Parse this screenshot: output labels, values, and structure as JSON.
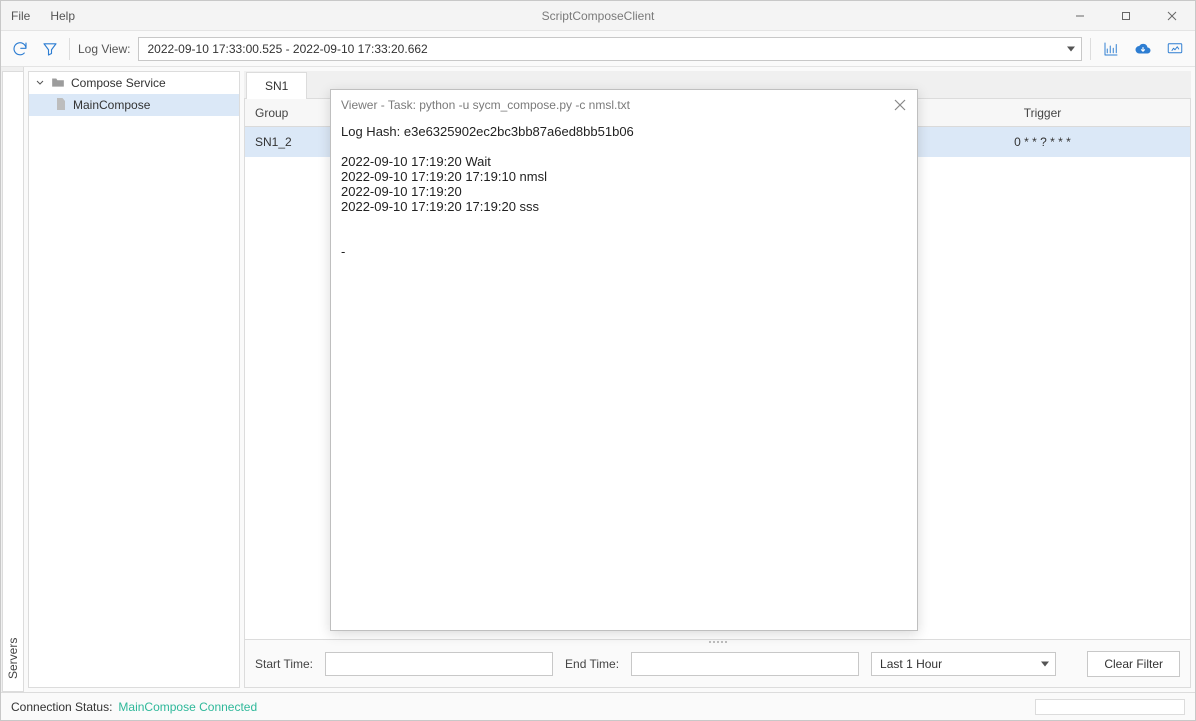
{
  "window": {
    "title": "ScriptComposeClient"
  },
  "menubar": {
    "file": "File",
    "help": "Help"
  },
  "toolbar": {
    "log_view_label": "Log View:",
    "log_view_value": "2022-09-10 17:33:00.525 - 2022-09-10 17:33:20.662"
  },
  "side_tab": {
    "label": "Servers"
  },
  "tree": {
    "root": "Compose Service",
    "child": "MainCompose"
  },
  "tabs": {
    "active": "SN1"
  },
  "grid": {
    "headers": {
      "group": "Group",
      "trigger": "Trigger"
    },
    "row": {
      "group": "SN1_2",
      "trigger": "0 * * ? * * *"
    }
  },
  "filter": {
    "start_label": "Start Time:",
    "end_label": "End Time:",
    "range_value": "Last 1 Hour",
    "clear": "Clear Filter"
  },
  "status": {
    "label": "Connection Status:",
    "value": "MainCompose Connected"
  },
  "viewer": {
    "title": "Viewer - Task: python -u sycm_compose.py -c nmsl.txt",
    "body": "Log Hash: e3e6325902ec2bc3bb87a6ed8bb51b06\n\n2022-09-10 17:19:20 Wait\n2022-09-10 17:19:20 17:19:10 nmsl\n2022-09-10 17:19:20\n2022-09-10 17:19:20 17:19:20 sss\n\n\n-"
  }
}
